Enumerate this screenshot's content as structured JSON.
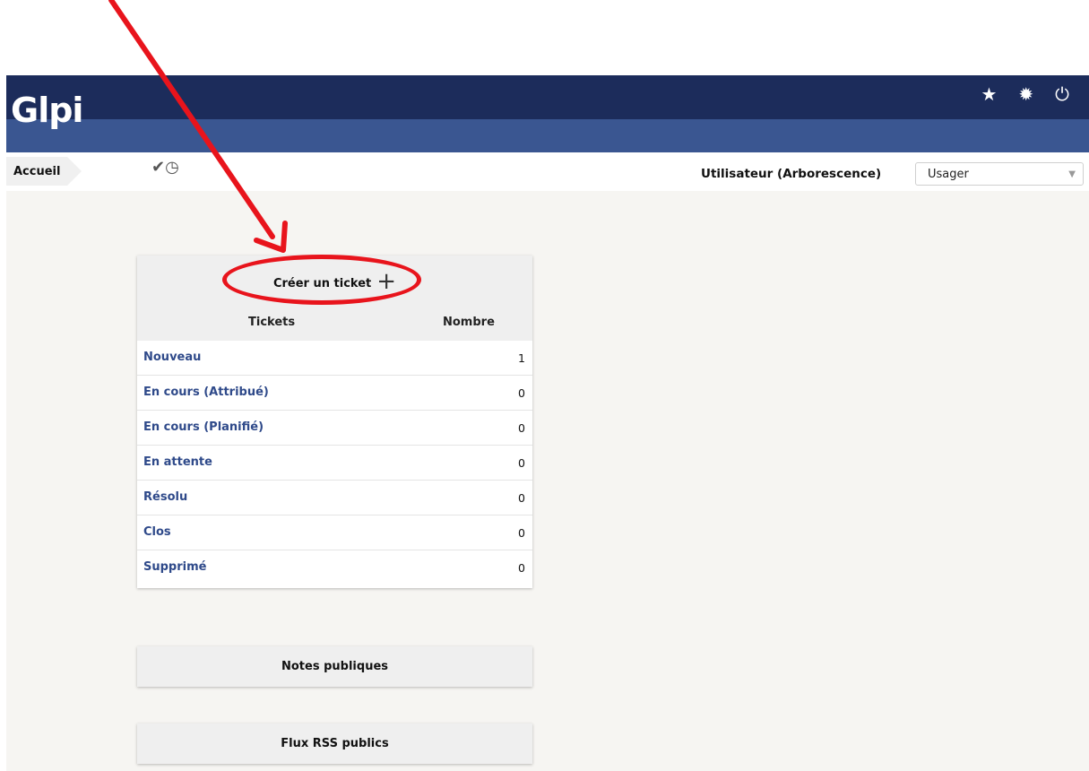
{
  "header": {
    "logo_text": "Glpi",
    "icons": [
      "star-icon",
      "gear-icon",
      "power-icon"
    ]
  },
  "nav": {
    "breadcrumb": "Accueil",
    "profile_label": "Utilisateur (Arborescence)",
    "profile_value": "Usager"
  },
  "tickets_panel": {
    "create_label": "Créer un ticket",
    "col_tickets": "Tickets",
    "col_count": "Nombre",
    "rows": [
      {
        "label": "Nouveau",
        "count": "1"
      },
      {
        "label": "En cours (Attribué)",
        "count": "0"
      },
      {
        "label": "En cours (Planifié)",
        "count": "0"
      },
      {
        "label": "En attente",
        "count": "0"
      },
      {
        "label": "Résolu",
        "count": "0"
      },
      {
        "label": "Clos",
        "count": "0"
      },
      {
        "label": "Supprimé",
        "count": "0"
      }
    ]
  },
  "notes_panel": {
    "title": "Notes publiques"
  },
  "rss_panel": {
    "title": "Flux RSS publics"
  },
  "colors": {
    "header_dark": "#1c2c5b",
    "header_light": "#3a5691",
    "link": "#2f4a8a",
    "annotation": "#e8141c"
  }
}
